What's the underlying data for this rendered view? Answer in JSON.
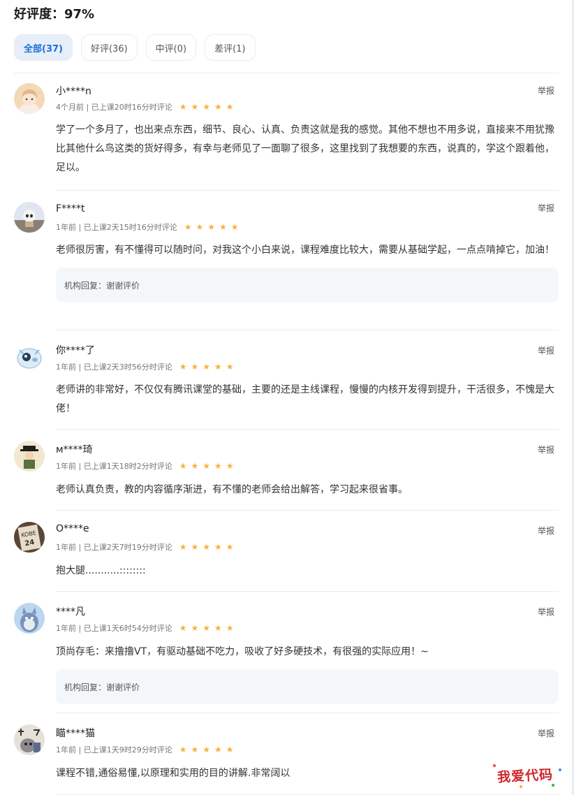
{
  "header": {
    "title": "好评度：97%"
  },
  "tabs": [
    {
      "label": "全部(37)",
      "active": true
    },
    {
      "label": "好评(36)",
      "active": false
    },
    {
      "label": "中评(0)",
      "active": false
    },
    {
      "label": "差评(1)",
      "active": false
    }
  ],
  "report_label": "举报",
  "rating_star_icon": "star-icon",
  "accent_color": "#1f6fd6",
  "star_color": "#f5b33d",
  "reviews": [
    {
      "name": "小****n",
      "time": "4个月前",
      "study": "已上课20时16分时评论",
      "rating": 5,
      "content": "学了一个多月了，也出来点东西，细节、良心、认真、负责这就是我的感觉。其他不想也不用多说，直接来不用犹豫比其他什么鸟这类的货好得多，有幸与老师见了一面聊了很多，这里找到了我想要的东西，说真的，学这个跟着他，足以。",
      "reply": ""
    },
    {
      "name": "F****t",
      "time": "1年前",
      "study": "已上课2天15时16分时评论",
      "rating": 5,
      "content": "老师很厉害，有不懂得可以随时问，对我这个小白来说，课程难度比较大，需要从基础学起，一点点啃掉它，加油！",
      "reply": "机构回复：谢谢评价"
    },
    {
      "name": "你****了",
      "time": "1年前",
      "study": "已上课2天3时56分时评论",
      "rating": 5,
      "content": "老师讲的非常好，不仅仅有腾讯课堂的基础，主要的还是主线课程，慢慢的内核开发得到提升，干活很多，不愧是大佬！",
      "reply": ""
    },
    {
      "name": "м****琦",
      "time": "1年前",
      "study": "已上课1天18时2分时评论",
      "rating": 5,
      "content": "老师认真负责，教的内容循序渐进，有不懂的老师会给出解答，学习起来很省事。",
      "reply": ""
    },
    {
      "name": "O****e",
      "time": "1年前",
      "study": "已上课2天7时19分时评论",
      "rating": 5,
      "content": "抱大腿...........::::::::",
      "reply": ""
    },
    {
      "name": "****凡",
      "time": "1年前",
      "study": "已上课1天6时54分时评论",
      "rating": 5,
      "content": "顶尚存毛：来撸撸VT，有驱动基础不吃力，吸收了好多硬技术，有很强的实际应用！~",
      "reply": "机构回复：谢谢评价"
    },
    {
      "name": "瞄****猫",
      "time": "1年前",
      "study": "已上课1天9时29分时评论",
      "rating": 5,
      "content": "课程不错,通俗易懂,以原理和实用的目的讲解.非常阔以",
      "reply": ""
    }
  ],
  "watermark": "我爱代码"
}
